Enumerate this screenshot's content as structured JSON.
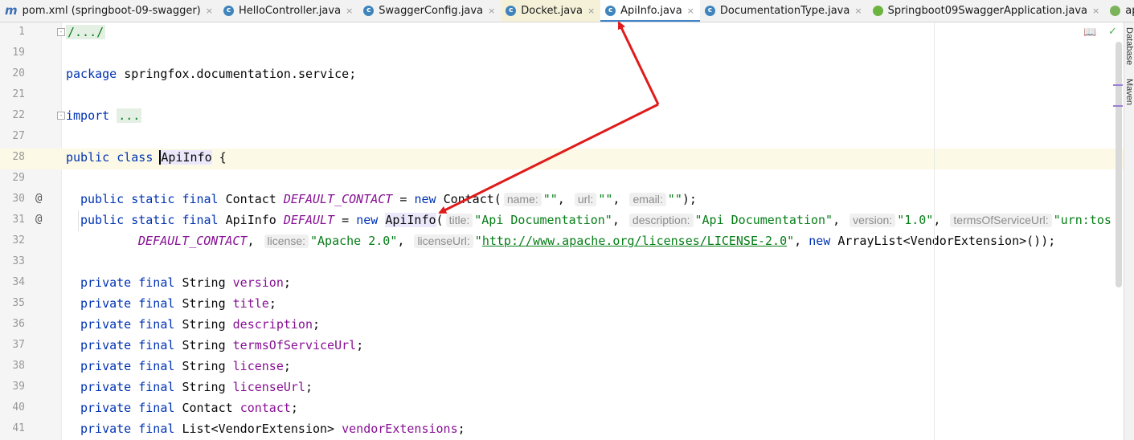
{
  "tabs": [
    {
      "icon": "maven-icon",
      "label": "pom.xml (springboot-09-swagger)",
      "active": false
    },
    {
      "icon": "class-icon",
      "label": "HelloController.java",
      "active": false
    },
    {
      "icon": "class-icon",
      "label": "SwaggerConfig.java",
      "active": false
    },
    {
      "icon": "class-icon",
      "label": "Docket.java",
      "active": false
    },
    {
      "icon": "class-icon",
      "label": "ApiInfo.java",
      "active": true
    },
    {
      "icon": "class-icon",
      "label": "DocumentationType.java",
      "active": false
    },
    {
      "icon": "spring-boot-icon",
      "label": "Springboot09SwaggerApplication.java",
      "active": false
    },
    {
      "icon": "spring-leaf-icon",
      "label": "applicatio",
      "active": false
    }
  ],
  "tab_glyphs": {
    "maven": "m",
    "class": "c",
    "close": "×"
  },
  "sidebar": {
    "database": "Database",
    "maven": "Maven"
  },
  "lines": {
    "l1": {
      "n": "1",
      "fold": "/.../"
    },
    "l19": {
      "n": "19"
    },
    "l20": {
      "n": "20",
      "kw": "package",
      "rest": " springfox.documentation.service;"
    },
    "l21": {
      "n": "21"
    },
    "l22": {
      "n": "22",
      "kw": "import",
      "folded": "..."
    },
    "l27": {
      "n": "27"
    },
    "l28": {
      "n": "28",
      "kw1": "public",
      "kw2": "class",
      "name": "ApiInfo",
      "rest": " {"
    },
    "l29": {
      "n": "29"
    },
    "l30": {
      "n": "30",
      "at": "@",
      "kw1": "public",
      "kw2": "static",
      "kw3": "final",
      "type": "Contact",
      "field": "DEFAULT_CONTACT",
      "eq": " = ",
      "kwnew": "new",
      "ctor": "Contact(",
      "h1": "name:",
      "v1": "\"\"",
      "h2": "url:",
      "v2": "\"\"",
      "h3": "email:",
      "v3": "\"\"",
      "end": ");"
    },
    "l31": {
      "n": "31",
      "at": "@",
      "kw1": "public",
      "kw2": "static",
      "kw3": "final",
      "type": "ApiInfo",
      "field": "DEFAULT",
      "eq": " = ",
      "kwnew": "new",
      "ctor": "ApiInfo",
      "paren": "(",
      "h1": "title:",
      "v1": "\"Api Documentation\"",
      "h2": "description:",
      "v2": "\"Api Documentation\"",
      "h3": "version:",
      "v3": "\"1.0\"",
      "h4": "termsOfServiceUrl:",
      "v4": "\"urn:tos"
    },
    "l32": {
      "n": "32",
      "field": "DEFAULT_CONTACT",
      "h1": "license:",
      "v1": "\"Apache 2.0\"",
      "h2": "licenseUrl:",
      "q": "\"",
      "url": "http://www.apache.org/licenses/LICENSE-2.0",
      "kwnew": "new",
      "rest": " ArrayList<VendorExtension>());"
    },
    "l33": {
      "n": "33"
    },
    "l34": {
      "n": "34",
      "kw1": "private",
      "kw2": "final",
      "type": "String",
      "field": "version"
    },
    "l35": {
      "n": "35",
      "kw1": "private",
      "kw2": "final",
      "type": "String",
      "field": "title"
    },
    "l36": {
      "n": "36",
      "kw1": "private",
      "kw2": "final",
      "type": "String",
      "field": "description"
    },
    "l37": {
      "n": "37",
      "kw1": "private",
      "kw2": "final",
      "type": "String",
      "field": "termsOfServiceUrl"
    },
    "l38": {
      "n": "38",
      "kw1": "private",
      "kw2": "final",
      "type": "String",
      "field": "license"
    },
    "l39": {
      "n": "39",
      "kw1": "private",
      "kw2": "final",
      "type": "String",
      "field": "licenseUrl"
    },
    "l40": {
      "n": "40",
      "kw1": "private",
      "kw2": "final",
      "type": "Contact",
      "field": "contact"
    },
    "l41": {
      "n": "41",
      "kw1": "private",
      "kw2": "final",
      "type": "List<VendorExtension>",
      "field": "vendorExtensions"
    }
  },
  "colors": {
    "keyword": "#0033b3",
    "field": "#871094",
    "string": "#067d17",
    "arrow": "#e01b1b",
    "tab_underline": "#4083c9"
  },
  "toolbar": {
    "reader_icon": "book-icon",
    "status_icon": "check-icon"
  }
}
